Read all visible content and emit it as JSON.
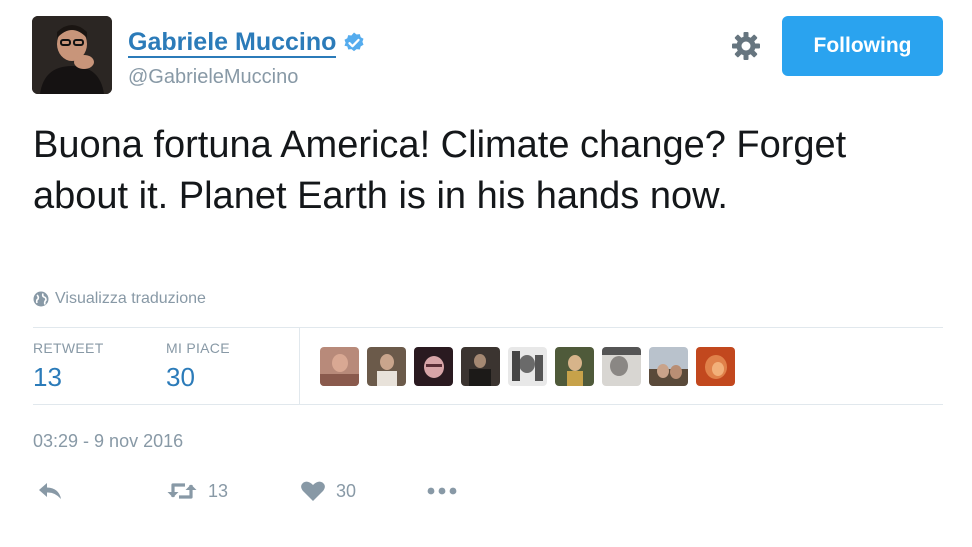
{
  "author": {
    "display_name": "Gabriele Muccino",
    "handle": "@GabrieleMuccino",
    "verified": true
  },
  "header": {
    "settings_icon": "gear-icon",
    "follow_label": "Following"
  },
  "tweet": {
    "text": "Buona fortuna America! Climate change? Forget about it. Planet Earth is in his hands now.",
    "translate_label": "Visualizza traduzione",
    "timestamp": "03:29 - 9 nov 2016"
  },
  "stats": {
    "retweet_label": "RETWEET",
    "retweet_count": "13",
    "like_label": "MI PIACE",
    "like_count": "30"
  },
  "actions": {
    "retweet_count": "13",
    "like_count": "30"
  },
  "colors": {
    "accent": "#2b7bb9",
    "button": "#2aa3ef",
    "muted": "#8899a6",
    "divider": "#e1e8ed"
  }
}
